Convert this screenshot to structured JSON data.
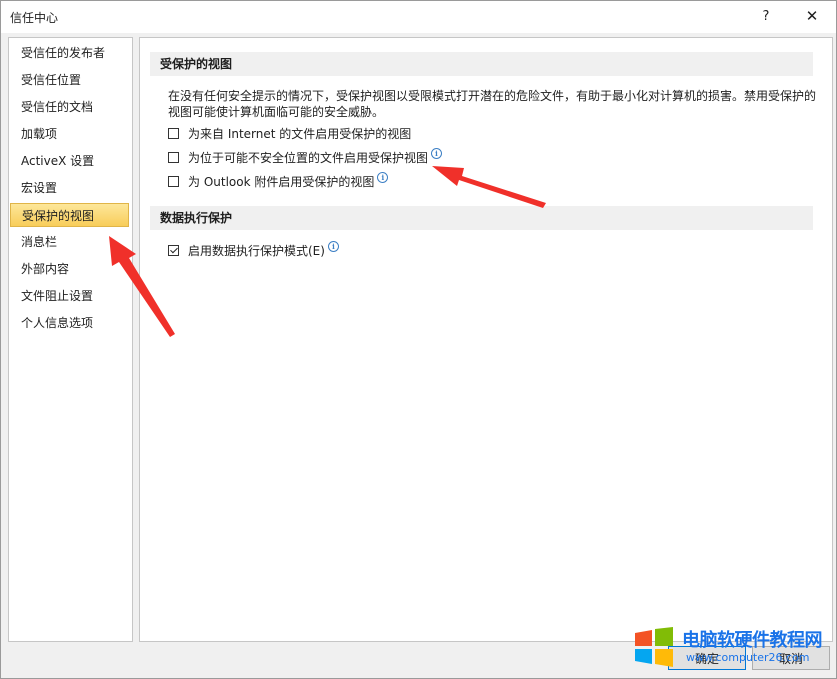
{
  "window": {
    "title": "信任中心",
    "help_label": "?",
    "close_label": "✕"
  },
  "sidebar": {
    "items": [
      {
        "label": "受信任的发布者"
      },
      {
        "label": "受信任位置"
      },
      {
        "label": "受信任的文档"
      },
      {
        "label": "加载项"
      },
      {
        "label": "ActiveX 设置"
      },
      {
        "label": "宏设置"
      },
      {
        "label": "受保护的视图",
        "selected": true
      },
      {
        "label": "消息栏"
      },
      {
        "label": "外部内容"
      },
      {
        "label": "文件阻止设置"
      },
      {
        "label": "个人信息选项"
      }
    ]
  },
  "protected_view": {
    "header": "受保护的视图",
    "description": "在没有任何安全提示的情况下，受保护视图以受限模式打开潜在的危险文件，有助于最小化对计算机的损害。禁用受保护的视图可能使计算机面临可能的安全威胁。",
    "options": [
      {
        "label": "为来自 Internet 的文件启用受保护的视图",
        "checked": false,
        "info": false
      },
      {
        "label": "为位于可能不安全位置的文件启用受保护视图",
        "checked": false,
        "info": true
      },
      {
        "label": "为 Outlook 附件启用受保护的视图",
        "checked": false,
        "info": true
      }
    ]
  },
  "dep": {
    "header": "数据执行保护",
    "option": {
      "label": "启用数据执行保护模式(E)",
      "checked": true,
      "info": true
    }
  },
  "footer": {
    "ok_label": "确定",
    "cancel_label": "取消"
  },
  "info_glyph": "i",
  "watermark": {
    "title": "电脑软硬件教程网",
    "url": "www.computer26.com"
  },
  "colors": {
    "selected_bg": "#f8cd5a",
    "arrow": "#f0302a",
    "watermark": "#1a73e8"
  }
}
